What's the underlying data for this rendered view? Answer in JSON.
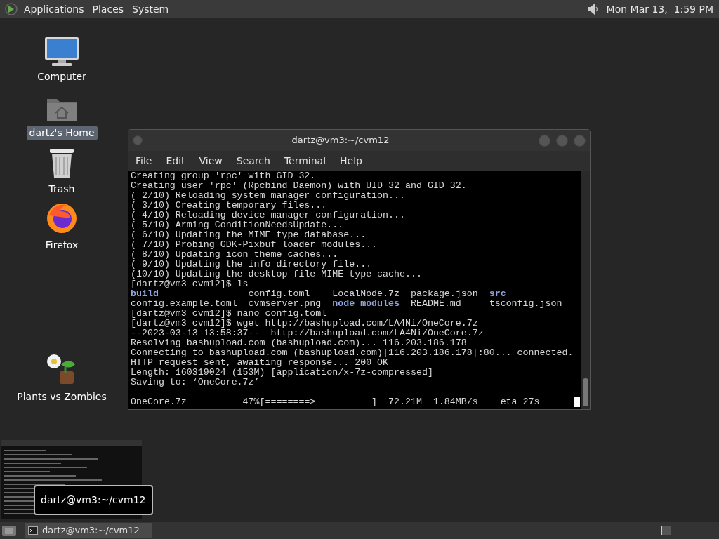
{
  "top_panel": {
    "menus": [
      "Applications",
      "Places",
      "System"
    ],
    "clock": "Mon Mar 13,  1:59 PM"
  },
  "desktop_icons": [
    {
      "kind": "computer",
      "label": "Computer",
      "selected": false
    },
    {
      "kind": "home",
      "label": "dartz's Home",
      "selected": true
    },
    {
      "kind": "trash",
      "label": "Trash",
      "selected": false
    },
    {
      "kind": "firefox",
      "label": "Firefox",
      "selected": false
    },
    {
      "kind": "game",
      "label": "Plants vs Zombies",
      "selected": false
    }
  ],
  "terminal": {
    "title": "dartz@vm3:~/cvm12",
    "menu": [
      "File",
      "Edit",
      "View",
      "Search",
      "Terminal",
      "Help"
    ],
    "lines": [
      "Creating group 'rpc' with GID 32.",
      "Creating user 'rpc' (Rpcbind Daemon) with UID 32 and GID 32.",
      "( 2/10) Reloading system manager configuration...",
      "( 3/10) Creating temporary files...",
      "( 4/10) Reloading device manager configuration...",
      "( 5/10) Arming ConditionNeedsUpdate...",
      "( 6/10) Updating the MIME type database...",
      "( 7/10) Probing GDK-Pixbuf loader modules...",
      "( 8/10) Updating icon theme caches...",
      "( 9/10) Updating the info directory file...",
      "(10/10) Updating the desktop file MIME type cache...",
      "[dartz@vm3 cvm12]$ ls",
      "**build**                config.toml    LocalNode.7z  package.json  **src**",
      "config.example.toml  cvmserver.png  **node_modules**  README.md     tsconfig.json",
      "[dartz@vm3 cvm12]$ nano config.toml",
      "[dartz@vm3 cvm12]$ wget http://bashupload.com/LA4Ni/OneCore.7z",
      "--2023-03-13 13:58:37--  http://bashupload.com/LA4Ni/OneCore.7z",
      "Resolving bashupload.com (bashupload.com)... 116.203.186.178",
      "Connecting to bashupload.com (bashupload.com)|116.203.186.178|:80... connected.",
      "HTTP request sent, awaiting response... 200 OK",
      "Length: 160319024 (153M) [application/x-7z-compressed]",
      "Saving to: ‘OneCore.7z’"
    ],
    "progress_line": "OneCore.7z          47%[========>          ]  72.21M  1.84MB/s    eta 27s"
  },
  "tooltip": "dartz@vm3:~/cvm12",
  "taskbar": {
    "tasks": [
      {
        "label": "dartz@vm3:~/cvm12",
        "selected": true
      }
    ]
  }
}
